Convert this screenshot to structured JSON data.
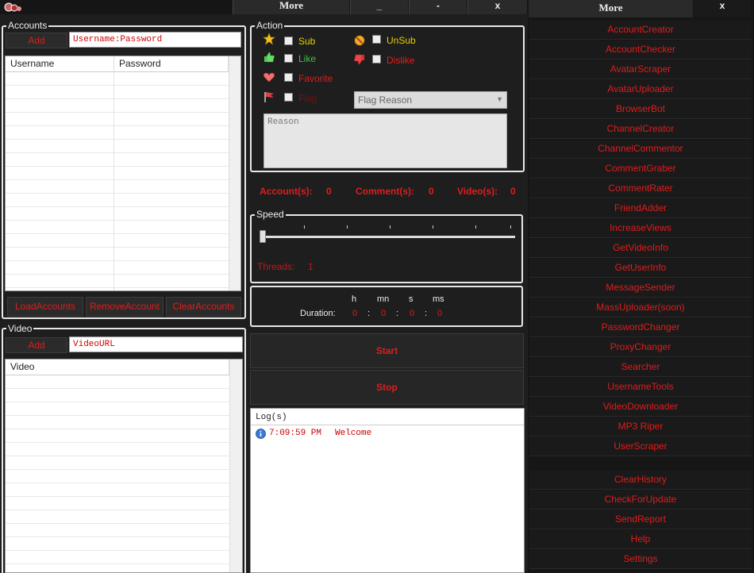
{
  "titlebar": {
    "logo": "app-logo-icon",
    "buttons": {
      "more": "More",
      "minimize": "_",
      "restore": "-",
      "close": "x"
    }
  },
  "accounts": {
    "legend": "Accounts",
    "add_label": "Add",
    "input_value": "Username:Password",
    "columns": [
      "Username",
      "Password"
    ],
    "load_label": "LoadAccounts",
    "remove_label": "RemoveAccount",
    "clear_label": "ClearAccounts"
  },
  "video": {
    "legend": "Video",
    "add_label": "Add",
    "input_value": "VideoURL",
    "columns": [
      "Video"
    ]
  },
  "action": {
    "legend": "Action",
    "sub": "Sub",
    "like": "Like",
    "favorite": "Favorite",
    "flag": "Flag",
    "unsub": "UnSub",
    "dislike": "Dislike",
    "flag_reason": "Flag Reason",
    "reason_placeholder": "Reason"
  },
  "counts": {
    "accounts_label": "Account(s):",
    "accounts_value": "0",
    "comments_label": "Comment(s):",
    "comments_value": "0",
    "videos_label": "Video(s):",
    "videos_value": "0"
  },
  "speed": {
    "legend": "Speed",
    "threads_label": "Threads:",
    "threads_value": "1",
    "slider_fraction": 0
  },
  "duration": {
    "label": "Duration:",
    "units": {
      "h": "h",
      "mn": "mn",
      "s": "s",
      "ms": "ms"
    },
    "values": {
      "h": "0",
      "mn": "0",
      "s": "0",
      "ms": "0"
    },
    "sep": ":"
  },
  "controls": {
    "start": "Start",
    "stop": "Stop"
  },
  "log": {
    "header": "Log(s)",
    "entries": [
      {
        "icon": "info-icon",
        "time": "7:09:59 PM",
        "message": "Welcome"
      }
    ]
  },
  "sidebar": {
    "more_label": "More",
    "close_label": "x",
    "tools": [
      "AccountCreator",
      "AccountChecker",
      "AvatarScraper",
      "AvatarUploader",
      "BrowserBot",
      "ChannelCreator",
      "ChannelCommentor",
      "CommentGraber",
      "CommentRater",
      "FriendAdder",
      "IncreaseViews",
      "GetVideoInfo",
      "GetUserInfo",
      "MessageSender",
      "MassUploader(soon)",
      "PasswordChanger",
      "ProxyChanger",
      "Searcher",
      "UsernameTools",
      "VideoDownloader",
      "MP3 Riper",
      "UserScraper"
    ],
    "utilities": [
      "ClearHistory",
      "CheckForUpdate",
      "SendReport",
      "Help",
      "Settings"
    ]
  },
  "colors": {
    "accent_red": "#e01c1c",
    "bg": "#1e1e1e",
    "yellow": "#e8d000",
    "green": "#3cc43c"
  }
}
